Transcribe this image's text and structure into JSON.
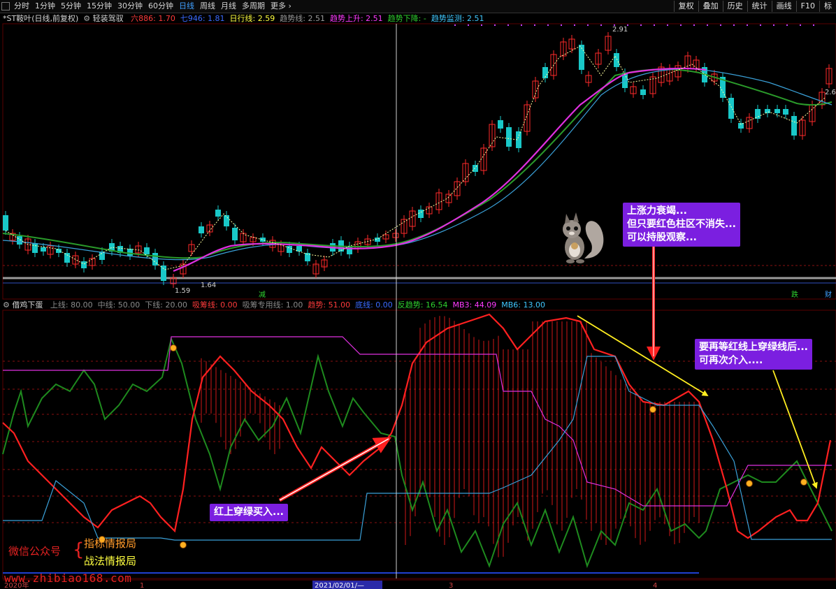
{
  "toolbar": {
    "periods": [
      "分时",
      "1分钟",
      "5分钟",
      "15分钟",
      "30分钟",
      "60分钟",
      "日线",
      "周线",
      "月线",
      "多周期",
      "更多"
    ],
    "active_period": "日线",
    "right_buttons": [
      "复权",
      "叠加",
      "历史",
      "统计",
      "画线",
      "F10",
      "标"
    ]
  },
  "main_info": {
    "stock": "*ST鞍叶(日线,前复权)",
    "indicator": "轻装驾驭",
    "items": [
      {
        "text": "六886: 1.70",
        "color": "#ff3b3b"
      },
      {
        "text": "七946: 1.81",
        "color": "#3b6bff"
      },
      {
        "text": "日行线: 2.59",
        "color": "#ffff40"
      },
      {
        "text": "趋势线: 2.51",
        "color": "#9a9a9a"
      },
      {
        "text": "趋势上升: 2.51",
        "color": "#ff3bff"
      },
      {
        "text": "趋势下降: -",
        "color": "#2fd12f"
      },
      {
        "text": "趋势监测: 2.51",
        "color": "#40c8ff"
      }
    ],
    "price_high": "2.91",
    "price_low_a": "1.59",
    "price_low_b": "1.64",
    "price_right": "2.6"
  },
  "marks": {
    "mark_a": "减",
    "mark_b": "跌",
    "mark_c": "财"
  },
  "sub_info": {
    "indicator": "借鸡下蛋",
    "items": [
      {
        "text": "上线: 80.00",
        "color": "#8a8a8a"
      },
      {
        "text": "中线: 50.00",
        "color": "#8a8a8a"
      },
      {
        "text": "下线: 20.00",
        "color": "#8a8a8a"
      },
      {
        "text": "吸筹线: 0.00",
        "color": "#ff3b3b"
      },
      {
        "text": "吸筹专用线: 1.00",
        "color": "#8a8a8a"
      },
      {
        "text": "趋势: 51.00",
        "color": "#ff3b3b"
      },
      {
        "text": "底线: 0.00",
        "color": "#3b6bff"
      },
      {
        "text": "反趋势: 16.54",
        "color": "#2fd12f"
      },
      {
        "text": "MB3: 44.09",
        "color": "#ff3bff"
      },
      {
        "text": "MB6: 13.00",
        "color": "#40c8ff"
      }
    ]
  },
  "annotations": {
    "callout1": [
      "上涨力衰竭...",
      "但只要红色柱区不消失...",
      "可以持股观察..."
    ],
    "callout2": [
      "要再等红线上穿绿线后...",
      "可再次介入...."
    ],
    "callout3": [
      "红上穿绿买入..."
    ]
  },
  "watermark": {
    "label": "微信公众号",
    "name1": "指标情报局",
    "name2": "战法情报局",
    "site": "www.zhibiao168.com"
  },
  "timeline": {
    "year": "2020年",
    "m1": "1",
    "date": "2021/02/01/—",
    "m3": "3",
    "m4": "4"
  },
  "colors": {
    "up": "#ff2a2a",
    "down": "#19c8c8",
    "ma_magenta": "#e030e0",
    "ma_green": "#2a9a2a",
    "ma_blue": "#3aa0d8",
    "green_line": "#1e8a1e",
    "red_line": "#ff2020",
    "callout_bg": "#7b1fe0"
  }
}
